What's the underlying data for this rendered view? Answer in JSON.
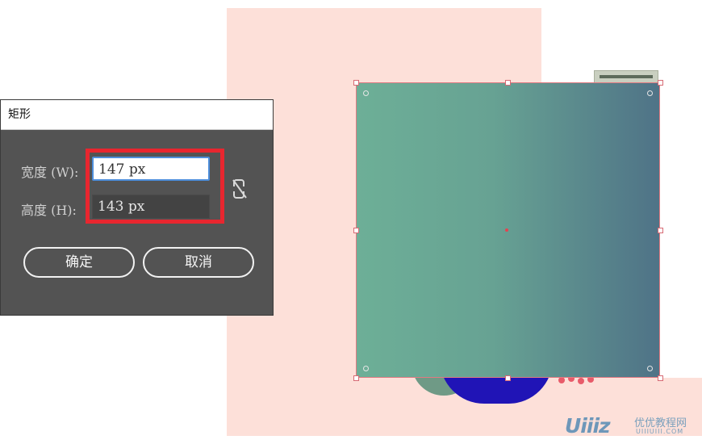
{
  "dialog": {
    "title": "矩形",
    "width_label": "宽度 (W):",
    "width_value": "147 px",
    "height_label": "高度 (H):",
    "height_value": "143 px",
    "ok_label": "确定",
    "cancel_label": "取消",
    "link_icon": "unlink-proportions-icon"
  },
  "watermark": {
    "logo": "Uiiiz",
    "name_cn": "优优教程网",
    "url": "UIIIUIII.COM"
  },
  "colors": {
    "artboard": "#fde0d9",
    "dialog_bg": "#535353",
    "highlight": "#e8262f",
    "gradient_start": "#6daf97",
    "gradient_end": "#4f7387",
    "selection": "#e07a82"
  }
}
